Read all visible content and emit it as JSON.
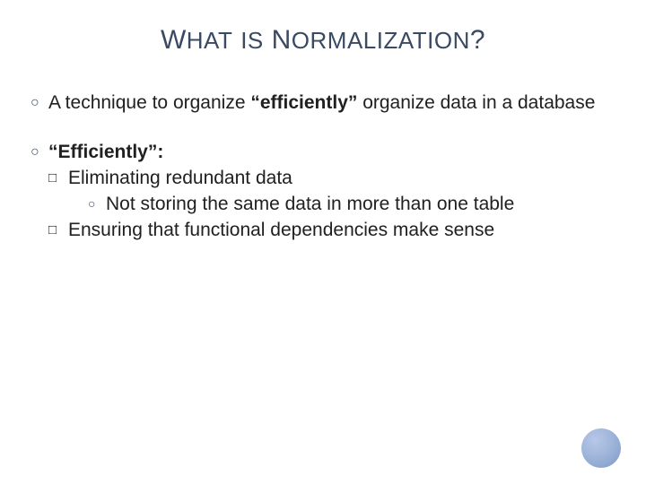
{
  "title": {
    "part1_big": "W",
    "part1_small": "HAT",
    "space1": " ",
    "part2_small": "IS",
    "space2": " ",
    "part3_big": "N",
    "part3_small": "ORMALIZATION",
    "qmark": "?"
  },
  "bullets": [
    {
      "runs": [
        {
          "text": "A technique to organize ",
          "bold": false
        },
        {
          "text": "“efficiently”",
          "bold": true
        },
        {
          "text": " organize data in a database",
          "bold": false
        }
      ]
    },
    {
      "runs": [
        {
          "text": "“Efficiently”:",
          "bold": true
        }
      ],
      "sub": [
        {
          "text": "Eliminating redundant data",
          "sub": [
            {
              "text": "Not storing the same data in more than one table"
            }
          ]
        },
        {
          "text": "Ensuring that functional dependencies make sense"
        }
      ]
    }
  ],
  "glyphs": {
    "donut": "○",
    "square": "□"
  }
}
